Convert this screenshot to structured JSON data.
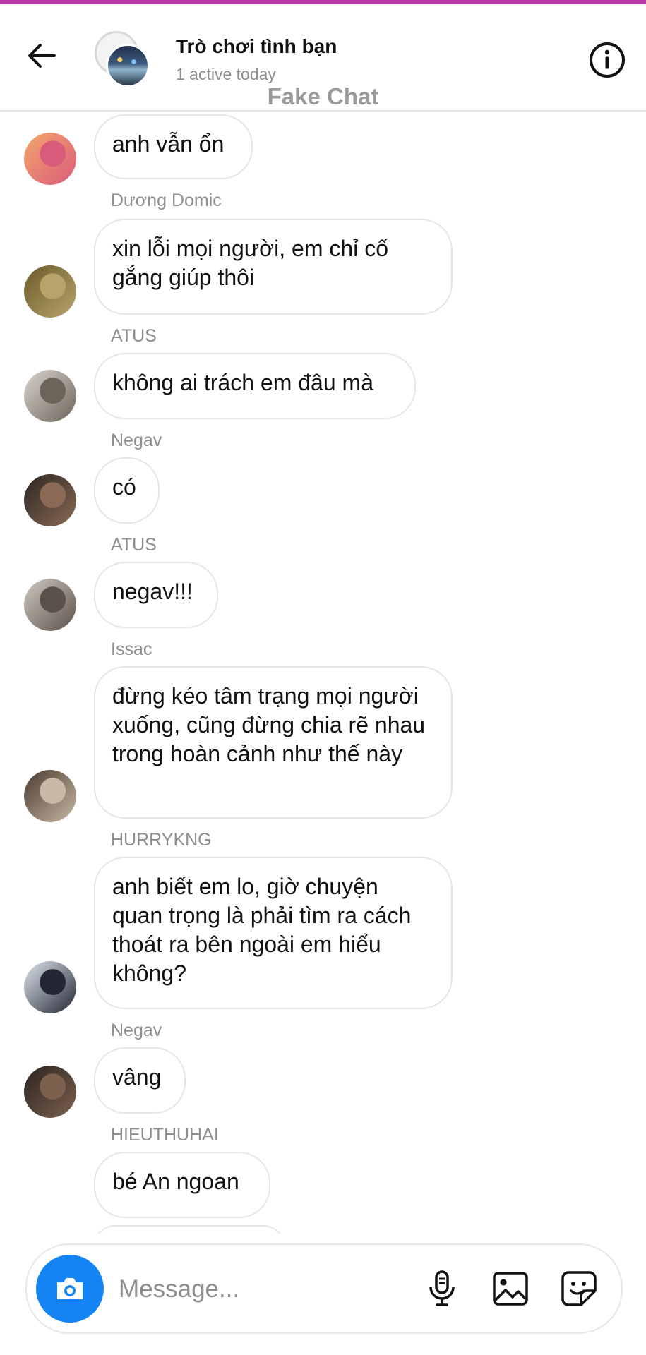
{
  "header": {
    "title": "Trò chơi tình bạn",
    "subtitle": "1 active today",
    "watermark": "Fake Chat"
  },
  "messages": [
    {
      "sender": "",
      "text": "anh vẫn ổn",
      "avatar_colors": [
        "#f3a76b",
        "#d95a7a"
      ]
    },
    {
      "sender": "Dương Domic",
      "text": "xin lỗi mọi người, em chỉ cố gắng giúp thôi",
      "avatar_colors": [
        "#6b5a2c",
        "#b8a46a"
      ]
    },
    {
      "sender": "ATUS",
      "text": "không ai trách em đâu mà",
      "avatar_colors": [
        "#d9d5cf",
        "#6d6358"
      ]
    },
    {
      "sender": "Negav",
      "text": "có",
      "avatar_colors": [
        "#2c2622",
        "#8a6a55"
      ]
    },
    {
      "sender": "ATUS",
      "text": "negav!!!",
      "avatar_colors": [
        "#cfc9c0",
        "#5c5148"
      ]
    },
    {
      "sender": "Issac",
      "text": "đừng kéo tâm trạng mọi người xuống, cũng đừng chia rẽ nhau trong hoàn cảnh như thế này",
      "avatar_colors": [
        "#4a3b30",
        "#c9b8a5"
      ]
    },
    {
      "sender": "HURRYKNG",
      "text": "anh biết em lo, giờ chuyện quan trọng là phải tìm ra cách thoát ra bên ngoài em hiểu không?",
      "avatar_colors": [
        "#dfe6ee",
        "#222733"
      ]
    },
    {
      "sender": "Negav",
      "text": "vâng",
      "avatar_colors": [
        "#2a2420",
        "#7d604e"
      ]
    },
    {
      "sender": "HIEUTHUHAI",
      "text": "bé An ngoan",
      "avatar_colors": [
        "",
        ""
      ]
    }
  ],
  "composer": {
    "placeholder": "Message..."
  },
  "icons": {
    "back": "arrow-left-icon",
    "info": "info-icon",
    "camera": "camera-icon",
    "mic": "microphone-icon",
    "gallery": "image-icon",
    "sticker": "sticker-icon"
  },
  "colors": {
    "accent": "#1484f4",
    "top_line": "#b83ba5",
    "secondary_text": "#8e8e8e",
    "bubble_border": "#e6e6e6"
  }
}
